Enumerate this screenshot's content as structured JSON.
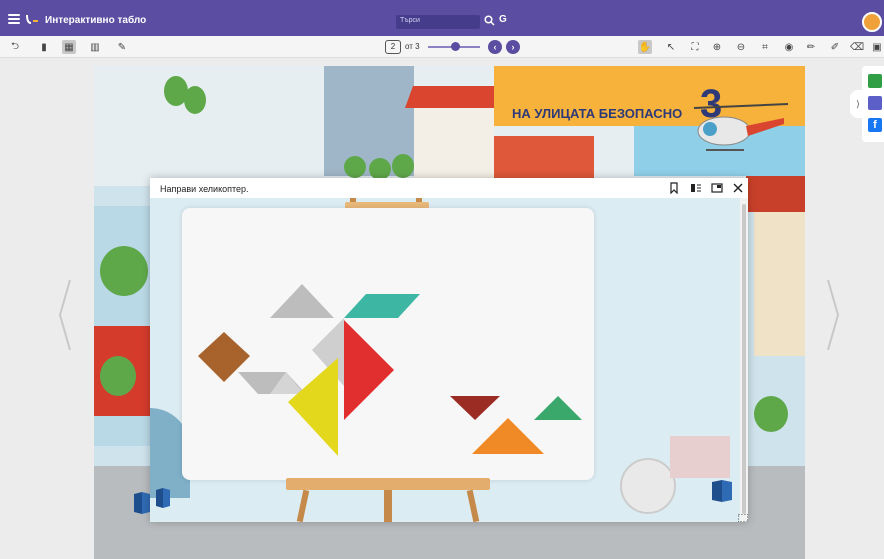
{
  "app": {
    "title": "Интерактивно табло",
    "search_placeholder": "Търси",
    "g_label": "G"
  },
  "toolbar": {
    "current_page": "2",
    "page_of": "от 3",
    "zoom_level": 0.45
  },
  "book_page": {
    "title": "НА УЛИЦАТА БЕЗОПАСНО",
    "number": "3"
  },
  "modal": {
    "title": "Направи хеликоптер."
  },
  "colors": {
    "brand": "#5b4ea2",
    "accent_orange": "#f6b23a",
    "tangram_gray": "#bdbdbd",
    "tangram_teal": "#3db7a4",
    "tangram_brown": "#a8622b",
    "tangram_yellow": "#e3d81c",
    "tangram_red": "#e12f2f",
    "tangram_darkred": "#9b2c24",
    "tangram_green": "#39a86a",
    "tangram_orange": "#f08a26"
  },
  "icons": {
    "menu": "hamburger-icon",
    "search": "search-icon",
    "back": "undo-icon",
    "bookmark": "bookmark-icon",
    "close": "close-icon"
  }
}
